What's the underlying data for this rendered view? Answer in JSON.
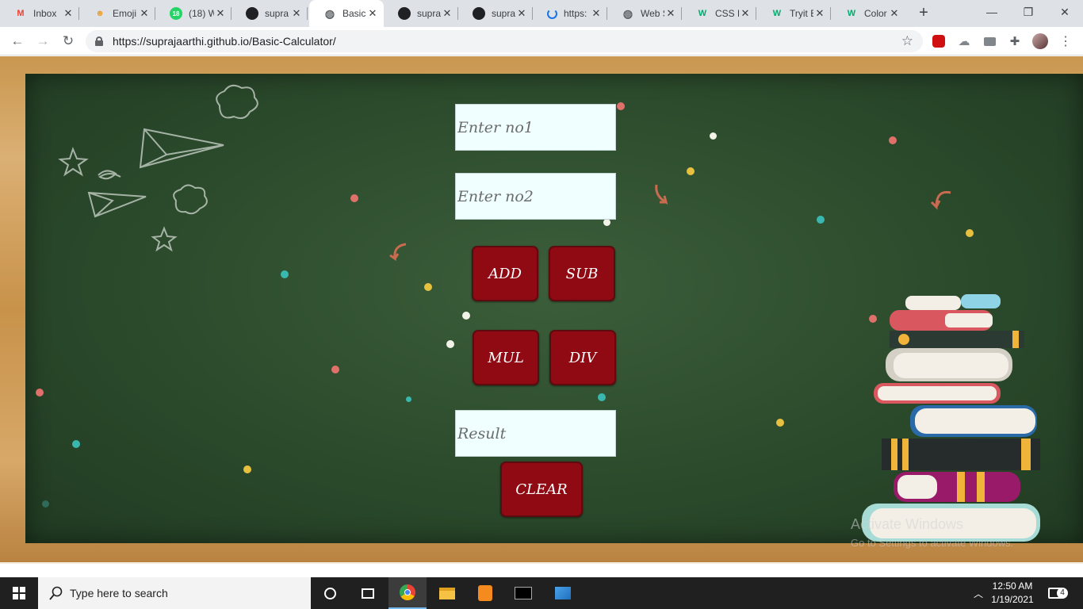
{
  "browser": {
    "tabs": [
      {
        "title": "Inbox",
        "icon": "gmail-icon",
        "color": "#ea4335"
      },
      {
        "title": "Emoji",
        "icon": "emoji-icon",
        "color": "#e8a33d"
      },
      {
        "title": "(18) W",
        "badge": "18",
        "icon": "whatsapp-icon",
        "color": "#25d366"
      },
      {
        "title": "supra",
        "icon": "github-icon",
        "color": "#202124"
      },
      {
        "title": "Basic",
        "icon": "globe-icon",
        "color": "#5f6368",
        "active": true
      },
      {
        "title": "supra",
        "icon": "github-icon",
        "color": "#202124"
      },
      {
        "title": "supra",
        "icon": "github-icon",
        "color": "#202124"
      },
      {
        "title": "https:",
        "icon": "loading-icon",
        "color": "#1a73e8"
      },
      {
        "title": "Web S",
        "icon": "globe-icon",
        "color": "#5f6368"
      },
      {
        "title": "CSS E",
        "icon": "w3schools-icon",
        "color": "#04aa6d"
      },
      {
        "title": "Tryit E",
        "icon": "w3schools-icon",
        "color": "#04aa6d"
      },
      {
        "title": "Color",
        "icon": "w3schools-icon",
        "color": "#04aa6d"
      }
    ],
    "url": "https://suprajaarthi.github.io/Basic-Calculator/"
  },
  "calculator": {
    "input1_placeholder": "Enter no1",
    "input2_placeholder": "Enter no2",
    "add_label": "ADD",
    "sub_label": "SUB",
    "mul_label": "MUL",
    "div_label": "DIV",
    "result_placeholder": "Result",
    "clear_label": "CLEAR",
    "button_color": "#8f0a13",
    "field_color": "#f0ffff"
  },
  "watermark": {
    "title": "Activate Windows",
    "subtitle": "Go to Settings to activate Windows."
  },
  "taskbar": {
    "search_placeholder": "Type here to search",
    "time": "12:50 AM",
    "date": "1/19/2021",
    "notification_count": "4"
  }
}
